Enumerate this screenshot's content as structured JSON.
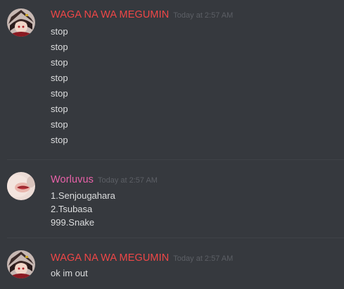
{
  "messages": [
    {
      "username": "WAGA NA WA MEGUMIN",
      "username_color": "#f04747",
      "timestamp": "Today at 2:57 AM",
      "avatar": "megumin-avatar",
      "lines": [
        "stop",
        "stop",
        "stop",
        "stop",
        "stop",
        "stop",
        "stop",
        "stop"
      ]
    },
    {
      "username": "Worluvus",
      "username_color": "#e962a9",
      "timestamp": "Today at 2:57 AM",
      "avatar": "worluvus-avatar",
      "lines": [
        "1.Senjougahara",
        "2.Tsubasa",
        "999.Snake"
      ]
    },
    {
      "username": "WAGA NA WA MEGUMIN",
      "username_color": "#f04747",
      "timestamp": "Today at 2:57 AM",
      "avatar": "megumin-avatar",
      "lines": [
        "ok im out"
      ]
    }
  ],
  "colors": {
    "background": "#36393e",
    "text": "#dcddde",
    "timestamp": "#5c5f65",
    "divider": "#3f4247"
  }
}
